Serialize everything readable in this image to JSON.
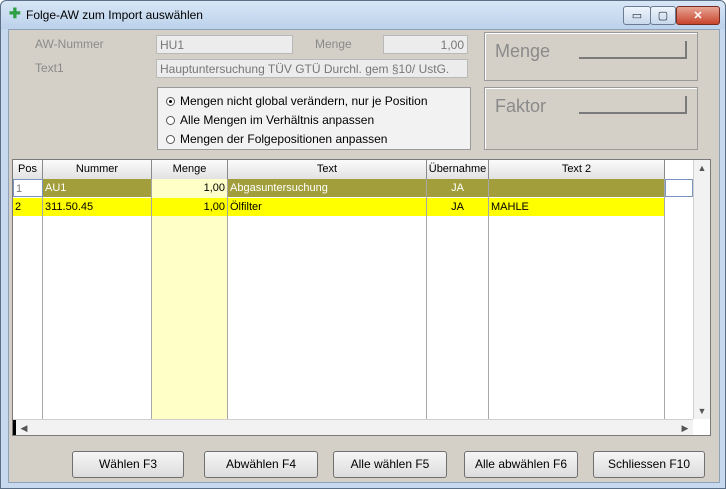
{
  "window": {
    "title": "Folge-AW zum Import auswählen",
    "controls": {
      "minimize": "▭",
      "maximize": "▢",
      "close": "✕"
    }
  },
  "form": {
    "aw_label": "AW-Nummer",
    "aw_value": "HU1",
    "menge_label": "Menge",
    "menge_value": "1,00",
    "text1_label": "Text1",
    "text1_value": "Hauptuntersuchung TÜV GTÜ Durchl. gem §10/ UstG."
  },
  "panels": {
    "menge": "Menge",
    "faktor": "Faktor"
  },
  "options": {
    "selected_index": 0,
    "items": [
      "Mengen nicht global verändern, nur je Position",
      "Alle Mengen im Verhältnis anpassen",
      "Mengen der Folgepositionen anpassen"
    ]
  },
  "table": {
    "columns": [
      "Pos",
      "Nummer",
      "Menge",
      "Text",
      "Übernahme",
      "Text 2"
    ],
    "rows": [
      {
        "pos": "1",
        "nummer": "AU1",
        "menge": "1,00",
        "text": "Abgasuntersuchung",
        "uebernahme": "JA",
        "text2": ""
      },
      {
        "pos": "2",
        "nummer": "311.50.45",
        "menge": "1,00",
        "text": "Ölfilter",
        "uebernahme": "JA",
        "text2": "MAHLE"
      }
    ]
  },
  "buttons": {
    "waehlen": "Wählen F3",
    "abwaehlen": "Abwählen F4",
    "alle_waehlen": "Alle wählen F5",
    "alle_abwaehlen": "Alle abwählen F6",
    "schliessen": "Schliessen F10"
  },
  "colors": {
    "row_selected": "#a29e3c",
    "row_highlight": "#ffff00",
    "menge_column": "#ffffc8"
  }
}
